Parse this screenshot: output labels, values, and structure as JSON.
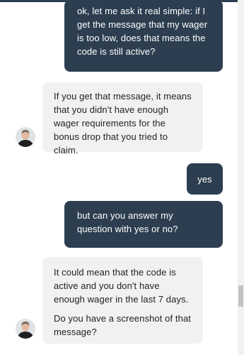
{
  "conversation": {
    "messages": [
      {
        "id": "msg-1",
        "sender": "user",
        "paragraphs": [
          "ok, let me ask it real simple: if I get the message that my wager is too low, does that means the code is still active?"
        ]
      },
      {
        "id": "msg-2",
        "sender": "agent",
        "paragraphs": [
          "If you get that message, it means that you didn't have enough wager requirements for the bonus drop that you tried to claim."
        ]
      },
      {
        "id": "msg-3",
        "sender": "user",
        "paragraphs": [
          "yes"
        ]
      },
      {
        "id": "msg-4",
        "sender": "user",
        "paragraphs": [
          "but can you answer my question with yes or no?"
        ]
      },
      {
        "id": "msg-5",
        "sender": "agent",
        "paragraphs": [
          "It could mean that the code is active and you don't have enough wager in the last 7 days.",
          "Do you have a screenshot of that message?"
        ]
      }
    ]
  },
  "colors": {
    "user_bubble": "#2c3e50",
    "agent_bubble": "#f1f1f1",
    "user_text": "#ffffff",
    "agent_text": "#222222"
  },
  "icons": {
    "agent_avatar": "support-agent-avatar-icon"
  }
}
